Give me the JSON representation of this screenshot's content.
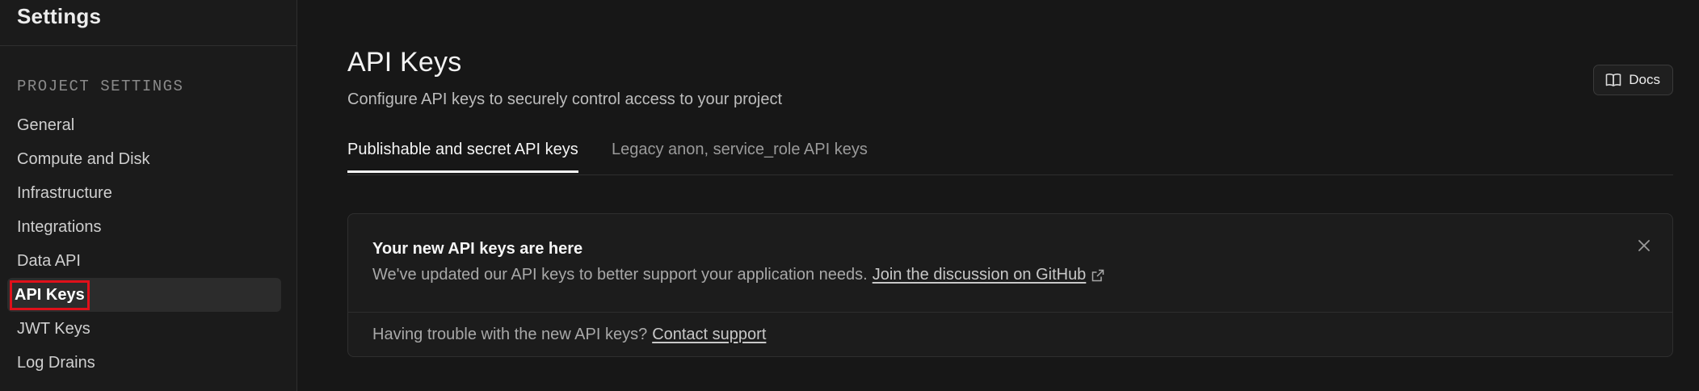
{
  "sidebar": {
    "title": "Settings",
    "section_label": "PROJECT SETTINGS",
    "items": [
      {
        "label": "General"
      },
      {
        "label": "Compute and Disk"
      },
      {
        "label": "Infrastructure"
      },
      {
        "label": "Integrations"
      },
      {
        "label": "Data API"
      },
      {
        "label": "API Keys",
        "active": true
      },
      {
        "label": "JWT Keys"
      },
      {
        "label": "Log Drains"
      }
    ]
  },
  "header": {
    "title": "API Keys",
    "subtitle": "Configure API keys to securely control access to your project",
    "docs_label": "Docs",
    "docs_icon": "book-icon"
  },
  "tabs": [
    {
      "label": "Publishable and secret API keys",
      "active": true
    },
    {
      "label": "Legacy anon, service_role API keys",
      "active": false
    }
  ],
  "callout": {
    "title": "Your new API keys are here",
    "text": "We've updated our API keys to better support your application needs.",
    "link": "Join the discussion on GitHub",
    "link_icon": "external-link-icon",
    "footer_text": "Having trouble with the new API keys?",
    "footer_link": "Contact support"
  },
  "colors": {
    "background": "#171717",
    "sidebar_bg": "#1b1b1b",
    "active_item_bg": "#2c2c2c",
    "highlight_box": "#e0101a"
  }
}
